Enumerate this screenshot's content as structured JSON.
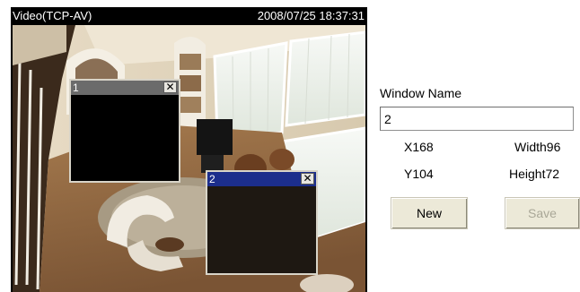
{
  "viewer": {
    "title": "Video(TCP-AV)",
    "timestamp": "2008/07/25 18:37:31"
  },
  "motion_windows": [
    {
      "number": "1",
      "close_label": "✕",
      "bar_color": "#6b6b6b",
      "selected": false
    },
    {
      "number": "2",
      "close_label": "✕",
      "bar_color": "#1c2e8c",
      "selected": true
    }
  ],
  "panel": {
    "window_name_label": "Window Name",
    "window_name_value": "2",
    "x_label": "X168",
    "width_label": "Width96",
    "y_label": "Y104",
    "height_label": "Height72",
    "new_button": "New",
    "save_button": "Save",
    "save_enabled": false
  }
}
